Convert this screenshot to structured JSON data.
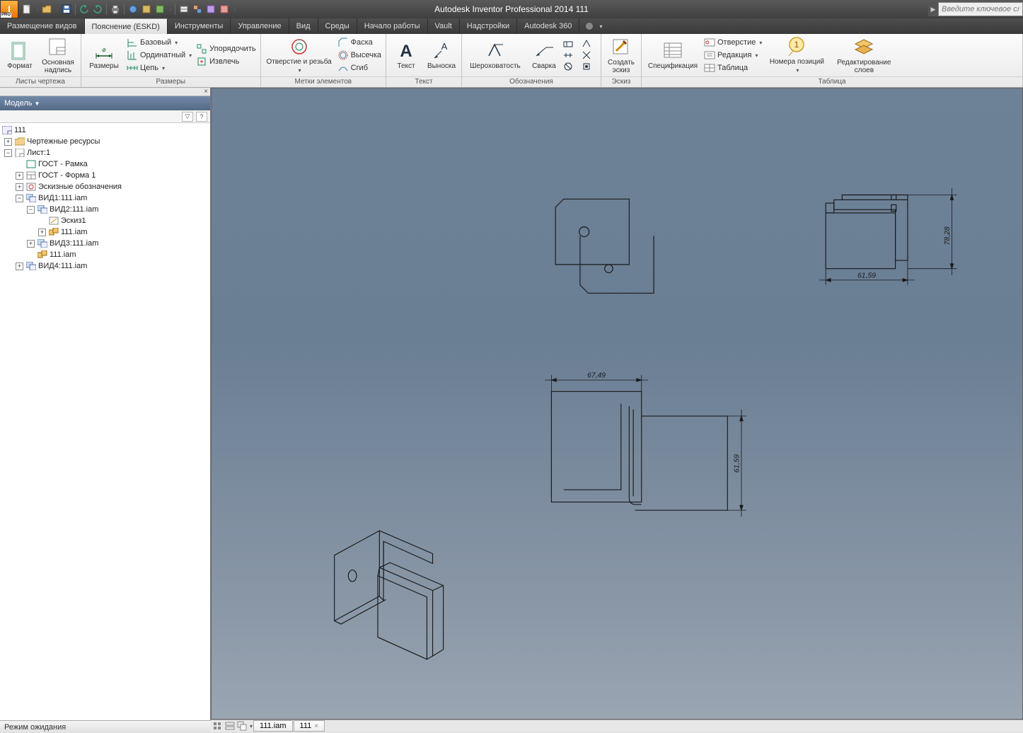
{
  "app": {
    "title": "Autodesk Inventor Professional 2014   111",
    "icon_label": "I",
    "icon_sub": "PRO"
  },
  "search": {
    "placeholder": "Введите ключевое сло"
  },
  "menu": {
    "tabs": [
      "Размещение видов",
      "Пояснение (ESKD)",
      "Инструменты",
      "Управление",
      "Вид",
      "Среды",
      "Начало работы",
      "Vault",
      "Надстройки",
      "Autodesk 360"
    ],
    "active_index": 1
  },
  "ribbon": {
    "groups": {
      "sheets": {
        "label": "Листы чертежа",
        "format": "Формат",
        "titleblock": "Основная\nнадпись"
      },
      "dims": {
        "label": "Размеры",
        "dim": "Размеры",
        "base": "Базовый",
        "ord": "Ординатный",
        "chain": "Цепь",
        "arrange": "Упорядочить",
        "retrieve": "Извлечь"
      },
      "features": {
        "label": "Метки элементов",
        "hole_thread": "Отверстие и резьба",
        "chamfer": "Фаска",
        "punch": "Высечка",
        "bend": "Сгиб"
      },
      "text": {
        "label": "Текст",
        "text": "Текст",
        "leader": "Выноска"
      },
      "symbols": {
        "label": "Обозначения",
        "surface": "Шероховатость",
        "weld": "Сварка"
      },
      "sketch": {
        "label": "Эскиз",
        "create": "Создать\nэскиз"
      },
      "table": {
        "label": "Таблица",
        "partslist": "Спецификация",
        "hole": "Отверстие",
        "revision": "Редакция",
        "general": "Таблица",
        "balloon": "Номера позиций",
        "layers": "Редактирование\nслоев"
      }
    }
  },
  "browser": {
    "title": "Модель",
    "root": "111",
    "items": {
      "drawres": "Чертежные ресурсы",
      "sheet": "Лист:1",
      "gost_frame": "ГОСТ - Рамка",
      "gost_form": "ГОСТ - Форма 1",
      "sketch_sym": "Эскизные обозначения",
      "view1": "ВИД1:111.iam",
      "view2": "ВИД2:111.iam",
      "sketch1": "Эскиз1",
      "asm111": "111.iam",
      "view3": "ВИД3:111.iam",
      "part111": "111.iam",
      "view4": "ВИД4:111.iam"
    }
  },
  "dimensions": {
    "d1": "67,49",
    "d2": "61,59",
    "d3": "61,59",
    "d4": "78,28"
  },
  "doc_tabs": {
    "tab1": "111.iam",
    "tab2": "111"
  },
  "status": {
    "text": "Режим ожидания"
  }
}
